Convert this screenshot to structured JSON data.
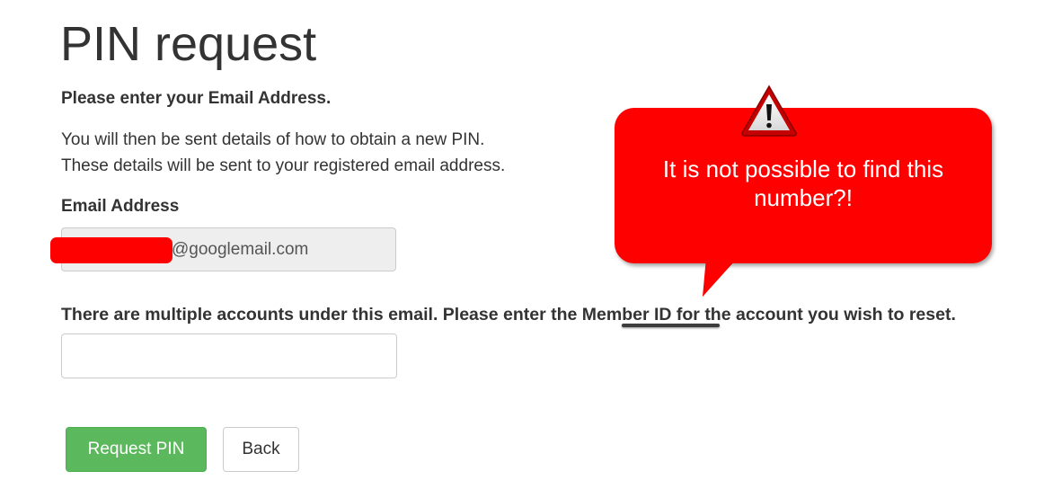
{
  "page": {
    "title": "PIN request",
    "instruction_bold": "Please enter your Email Address.",
    "instruction_line1": "You will then be sent details of how to obtain a new PIN.",
    "instruction_line2": "These details will be sent to your registered email address."
  },
  "email": {
    "label": "Email Address",
    "value_visible": "@googlemail.com",
    "redaction_color": "#ff0000"
  },
  "member": {
    "prompt_before": "There are multiple accounts under this email. Please enter the ",
    "prompt_highlight": "Member ID",
    "prompt_after": " for the account you wish to reset.",
    "input_value": ""
  },
  "buttons": {
    "request_label": "Request PIN",
    "back_label": "Back",
    "primary_color": "#5cb85c"
  },
  "annotation": {
    "callout_text": "It is not possible to find this number?!",
    "callout_color": "#ff0000",
    "icon": "warning-icon"
  }
}
